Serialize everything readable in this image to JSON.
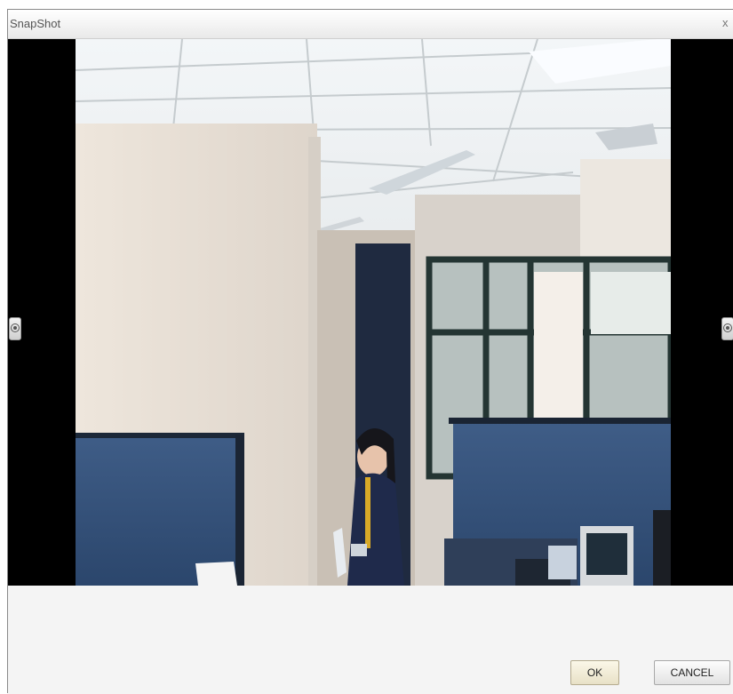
{
  "dialog": {
    "title": "SnapShot",
    "close_label": "x"
  },
  "viewer": {
    "prev_icon": "circle-left-icon",
    "next_icon": "circle-right-icon"
  },
  "footer": {
    "ok_label": "OK",
    "cancel_label": "CANCEL"
  }
}
